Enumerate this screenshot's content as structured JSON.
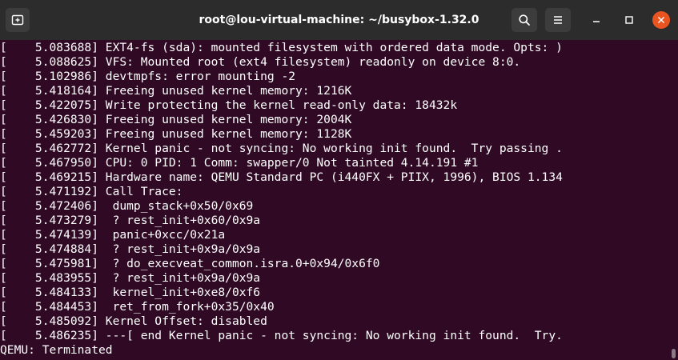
{
  "window": {
    "title": "root@lou-virtual-machine: ~/busybox-1.32.0"
  },
  "icons": {
    "new_tab": "new-tab-icon",
    "search": "search-icon",
    "menu": "hamburger-menu-icon",
    "minimize": "minimize-icon",
    "maximize": "maximize-icon",
    "close": "close-icon"
  },
  "colors": {
    "terminal_bg": "#300a24",
    "titlebar_bg": "#2c2c2c",
    "button_bg": "#3c3c3c",
    "close_accent": "#e95420",
    "text": "#ffffff"
  },
  "terminal": {
    "lines": [
      "[    5.083688] EXT4-fs (sda): mounted filesystem with ordered data mode. Opts: )",
      "[    5.088625] VFS: Mounted root (ext4 filesystem) readonly on device 8:0.",
      "[    5.102986] devtmpfs: error mounting -2",
      "[    5.418164] Freeing unused kernel memory: 1216K",
      "[    5.422075] Write protecting the kernel read-only data: 18432k",
      "[    5.426830] Freeing unused kernel memory: 2004K",
      "[    5.459203] Freeing unused kernel memory: 1128K",
      "[    5.462772] Kernel panic - not syncing: No working init found.  Try passing .",
      "[    5.467950] CPU: 0 PID: 1 Comm: swapper/0 Not tainted 4.14.191 #1",
      "[    5.469215] Hardware name: QEMU Standard PC (i440FX + PIIX, 1996), BIOS 1.134",
      "[    5.471192] Call Trace:",
      "[    5.472406]  dump_stack+0x50/0x69",
      "[    5.473279]  ? rest_init+0x60/0x9a",
      "[    5.474139]  panic+0xcc/0x21a",
      "[    5.474884]  ? rest_init+0x9a/0x9a",
      "[    5.475981]  ? do_execveat_common.isra.0+0x94/0x6f0",
      "[    5.483955]  ? rest_init+0x9a/0x9a",
      "[    5.484133]  kernel_init+0xe8/0xf6",
      "[    5.484453]  ret_from_fork+0x35/0x40",
      "[    5.485092] Kernel Offset: disabled",
      "[    5.486235] ---[ end Kernel panic - not syncing: No working init found.  Try.",
      "QEMU: Terminated"
    ]
  }
}
